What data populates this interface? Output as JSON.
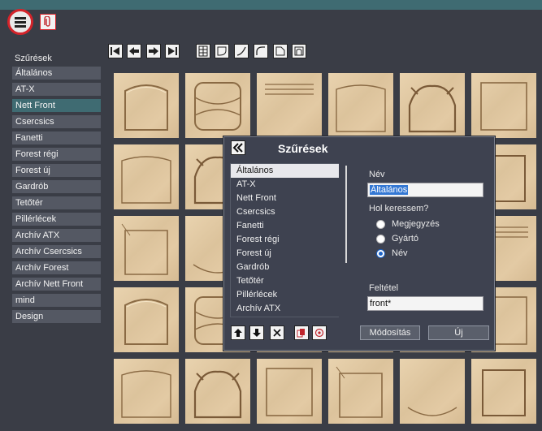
{
  "toolbar_top": {
    "menu_icon": "hamburger-menu-icon",
    "attach_icon": "paperclip-icon"
  },
  "sidebar": {
    "title": "Szűrések",
    "items": [
      {
        "label": "Általános"
      },
      {
        "label": "AT-X"
      },
      {
        "label": "Nett Front",
        "active": true
      },
      {
        "label": "Csercsics"
      },
      {
        "label": "Fanetti"
      },
      {
        "label": "Forest régi"
      },
      {
        "label": "Forest új"
      },
      {
        "label": "Gardrób"
      },
      {
        "label": "Tetőtér"
      },
      {
        "label": "Pillérlécek"
      },
      {
        "label": "Archív ATX"
      },
      {
        "label": "Archív Csercsics"
      },
      {
        "label": "Archív Forest"
      },
      {
        "label": "Archív Nett Front"
      },
      {
        "label": "mind"
      },
      {
        "label": "Design"
      }
    ]
  },
  "toolbar": {
    "nav_icons": [
      "first-page-icon",
      "previous-icon",
      "next-icon",
      "last-page-icon"
    ],
    "shape_icons": [
      "grid-frame-icon",
      "rounded-corner-icon",
      "diagonal-curve-icon",
      "arc-corner-icon",
      "cut-corner-icon",
      "arch-frame-icon"
    ]
  },
  "dialog": {
    "title": "Szűrések",
    "back_icon": "double-chevron-left-icon",
    "list": [
      "Általános",
      "AT-X",
      "Nett Front",
      "Csercsics",
      "Fanetti",
      "Forest régi",
      "Forest új",
      "Gardrób",
      "Tetőtér",
      "Pillérlécek",
      "Archív ATX"
    ],
    "selected_index": 0,
    "name_label": "Név",
    "name_value": "Általános",
    "search_label": "Hol keressem?",
    "radio_options": [
      {
        "label": "Megjegyzés",
        "checked": false
      },
      {
        "label": "Gyártó",
        "checked": false
      },
      {
        "label": "Név",
        "checked": true
      }
    ],
    "condition_label": "Feltétel",
    "condition_value": "front*",
    "modify_label": "Módosítás",
    "new_label": "Új",
    "action_icons": [
      "arrow-up-icon",
      "arrow-down-icon",
      "delete-x-icon",
      "copy-icon",
      "target-icon"
    ]
  },
  "colors": {
    "background": "#3a3d46",
    "accent": "#3f6b72",
    "highlight": "#d4232a"
  }
}
